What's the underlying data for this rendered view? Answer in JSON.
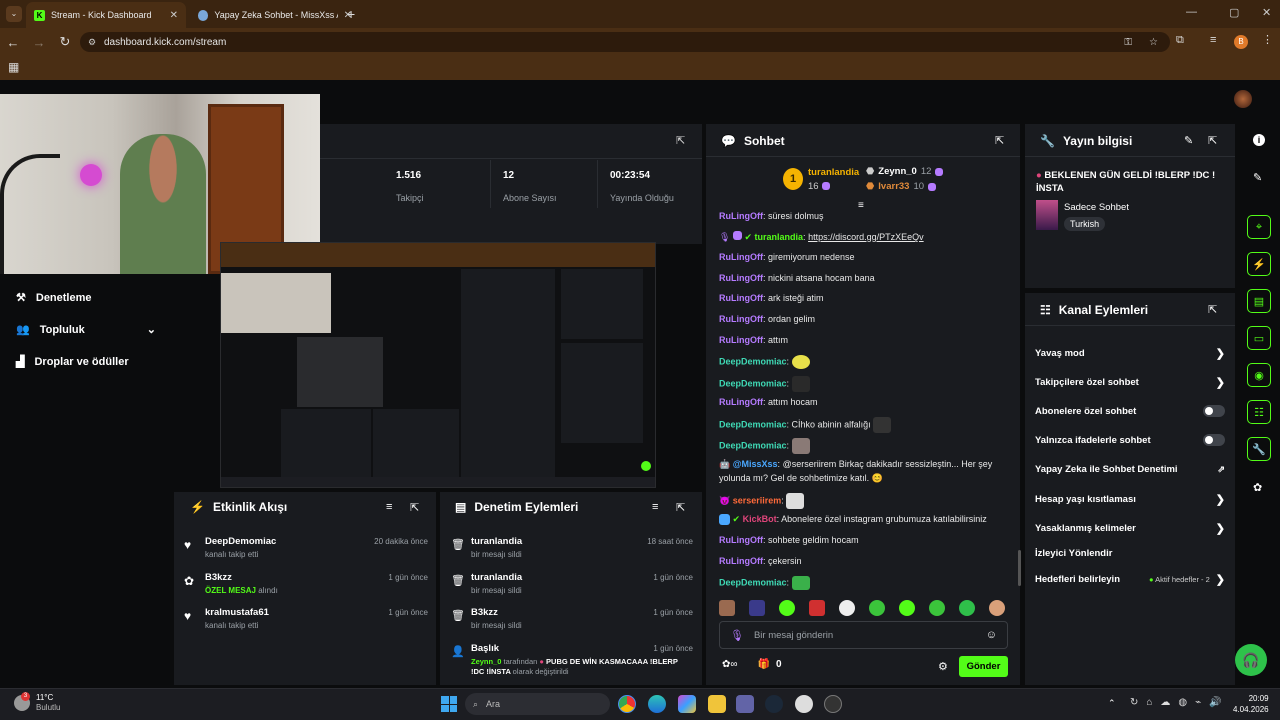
{
  "browser": {
    "tabs": [
      {
        "title": "Stream - Kick Dashboard",
        "active": true
      },
      {
        "title": "Yapay Zeka Sohbet - MissXss Al",
        "active": false
      }
    ],
    "url": "dashboard.kick.com/stream",
    "profile_initial": "B"
  },
  "stats": [
    {
      "value": "1.516",
      "label": "Takipçi"
    },
    {
      "value": "12",
      "label": "Abone Sayısı"
    },
    {
      "value": "00:23:54",
      "label": "Yayında Olduğu"
    }
  ],
  "left_nav": [
    {
      "label": "Denetleme"
    },
    {
      "label": "Topluluk"
    },
    {
      "label": "Droplar ve ödüller"
    }
  ],
  "activity": {
    "title": "Etkinlik Akışı",
    "items": [
      {
        "user": "DeepDemomiac",
        "detail": "kanalı takip etti",
        "time": "20 dakika önce"
      },
      {
        "user": "B3kzz",
        "detail_highlight": "ÖZEL MESAJ",
        "detail": "alındı",
        "time": "1 gün önce"
      },
      {
        "user": "kralmustafa61",
        "detail": "kanalı takip etti",
        "time": "1 gün önce"
      }
    ]
  },
  "moderation": {
    "title": "Denetim Eylemleri",
    "items": [
      {
        "user": "turanlandia",
        "detail": "bir mesajı sildi",
        "time": "18 saat önce"
      },
      {
        "user": "turanlandia",
        "detail": "bir mesajı sildi",
        "time": "1 gün önce"
      },
      {
        "user": "B3kzz",
        "detail": "bir mesajı sildi",
        "time": "1 gün önce"
      }
    ],
    "last": {
      "title": "Başlık",
      "time": "1 gün önce",
      "by": "Zeynn_0",
      "by_text": "tarafından",
      "value": "PUBG DE WİN KASMACAAA !BLERP !DC !İNSTA",
      "suffix": "olarak değiştirildi"
    }
  },
  "chat": {
    "title": "Sohbet",
    "top": {
      "first": {
        "rank": "1",
        "name": "turanlandia",
        "count": "16"
      },
      "second": {
        "name": "Zeynn_0",
        "count": "12"
      },
      "third": {
        "name": "Ivarr33",
        "count": "10"
      }
    },
    "messages": [
      {
        "user": "RuLingOff",
        "text": "süresi dolmuş"
      },
      {
        "user": "turanlandia",
        "text": "https://discord.gg/PTzXEeQv"
      },
      {
        "user": "RuLingOff",
        "text": "giremiyorum nedense"
      },
      {
        "user": "RuLingOff",
        "text": "nickini atsana hocam bana"
      },
      {
        "user": "RuLingOff",
        "text": "ark isteği atim"
      },
      {
        "user": "RuLingOff",
        "text": "ordan gelim"
      },
      {
        "user": "RuLingOff",
        "text": "attım"
      },
      {
        "user": "DeepDemomiac",
        "text": ""
      },
      {
        "user": "DeepDemomiac",
        "text": ""
      },
      {
        "user": "RuLingOff",
        "text": "attım hocam"
      },
      {
        "user": "DeepDemomiac",
        "text": "Cİhko abinin alfalığı"
      },
      {
        "user": "DeepDemomiac",
        "text": ""
      },
      {
        "user": "@MissXss",
        "text": "@serseriirem Birkaç dakikadır sessizleştin... Her şey"
      },
      {
        "user": "",
        "text": "yolunda mı? Gel de sohbetimize katıl. 😊"
      },
      {
        "user": "serseriirem",
        "text": ""
      },
      {
        "user": "KickBot",
        "text": "Abonelere özel instagram grubumuza katılabilirsiniz"
      },
      {
        "user": "RuLingOff",
        "text": "sohbete geldim hocam"
      },
      {
        "user": "RuLingOff",
        "text": "çekersin"
      },
      {
        "user": "DeepDemomiac",
        "text": ""
      }
    ],
    "input_placeholder": "Bir mesaj gönderin",
    "gift_count": "0",
    "send_label": "Gönder"
  },
  "stream_info": {
    "title": "Yayın bilgisi",
    "stream_title": "BEKLENEN GÜN GELDİ !BLERP !DC ! İNSTA",
    "category": "Sadece Sohbet",
    "tag": "Turkish"
  },
  "channel_actions": {
    "title": "Kanal Eylemleri",
    "items": [
      {
        "label": "Yavaş mod",
        "control": "chevron"
      },
      {
        "label": "Takipçilere özel sohbet",
        "control": "chevron"
      },
      {
        "label": "Abonelere özel sohbet",
        "control": "toggle"
      },
      {
        "label": "Yalnızca ifadelerle sohbet",
        "control": "toggle"
      },
      {
        "label": "Yapay Zeka ile Sohbet Denetimi",
        "control": "external"
      },
      {
        "label": "Hesap yaşı kısıtlaması",
        "control": "chevron"
      },
      {
        "label": "Yasaklanmış kelimeler",
        "control": "chevron"
      },
      {
        "label": "İzleyici Yönlendir",
        "control": "none"
      },
      {
        "label": "Hedefleri belirleyin",
        "control": "chevron",
        "badge": "Aktif hedefler - 2"
      }
    ]
  },
  "taskbar": {
    "weather_temp": "11°C",
    "weather_desc": "Bulutlu",
    "notif_count": "3",
    "search_placeholder": "Ara",
    "time": "20:09",
    "date": "4.04.2026"
  },
  "colors": {
    "accent": "#53fc18",
    "panel": "#191b1f",
    "chrome": "#4a2e14"
  }
}
